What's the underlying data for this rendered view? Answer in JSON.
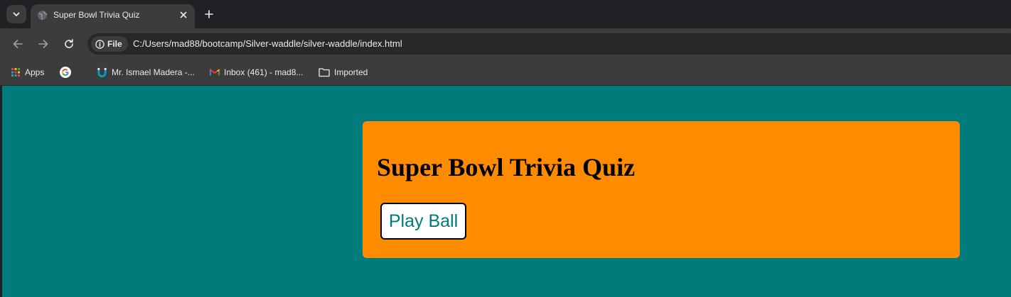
{
  "browser": {
    "tab": {
      "title": "Super Bowl Trivia Quiz"
    },
    "omnibox": {
      "site_chip_label": "File",
      "url": "C:/Users/mad88/bootcamp/Silver-waddle/silver-waddle/index.html"
    },
    "bookmarks": [
      {
        "label": "Apps",
        "icon": "apps-grid-icon"
      },
      {
        "label": "",
        "icon": "google-icon"
      },
      {
        "label": "Mr. Ismael Madera -...",
        "icon": "magnet-icon"
      },
      {
        "label": "Inbox (461) - mad8...",
        "icon": "gmail-icon"
      },
      {
        "label": "Imported",
        "icon": "folder-icon"
      }
    ]
  },
  "page": {
    "title": "Super Bowl Trivia Quiz",
    "play_button_label": "Play Ball"
  },
  "colors": {
    "page_background": "#007b7b",
    "card_background": "#ff8c00",
    "button_text": "#007b7b",
    "browser_chrome": "#3c3c3c",
    "tab_strip": "#202124"
  }
}
